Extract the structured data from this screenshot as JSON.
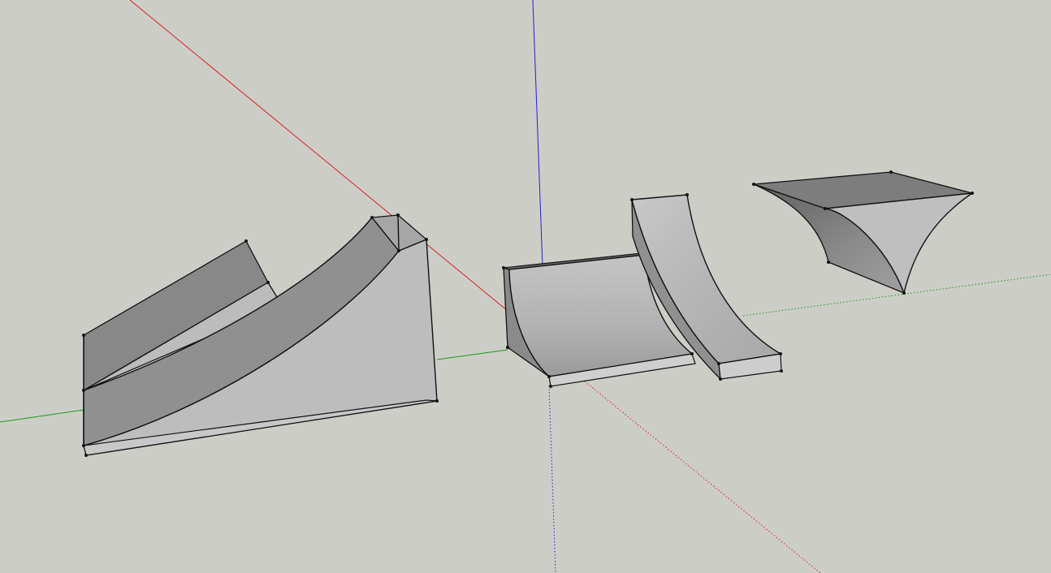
{
  "viewport": {
    "background_color": "#cdcdc8",
    "axes": {
      "red_axis_color": "#d22222",
      "green_axis_color": "#1a9a1a",
      "blue_axis_color": "#2222cc"
    },
    "face_colors": {
      "light": "#bdbdbd",
      "mid": "#a3a3a3",
      "dark": "#808080",
      "edge": "#111111"
    },
    "objects": [
      {
        "name": "curved-ramp-with-slope"
      },
      {
        "name": "quarter-pipe"
      },
      {
        "name": "curved-wall"
      },
      {
        "name": "curved-wedge"
      }
    ]
  }
}
